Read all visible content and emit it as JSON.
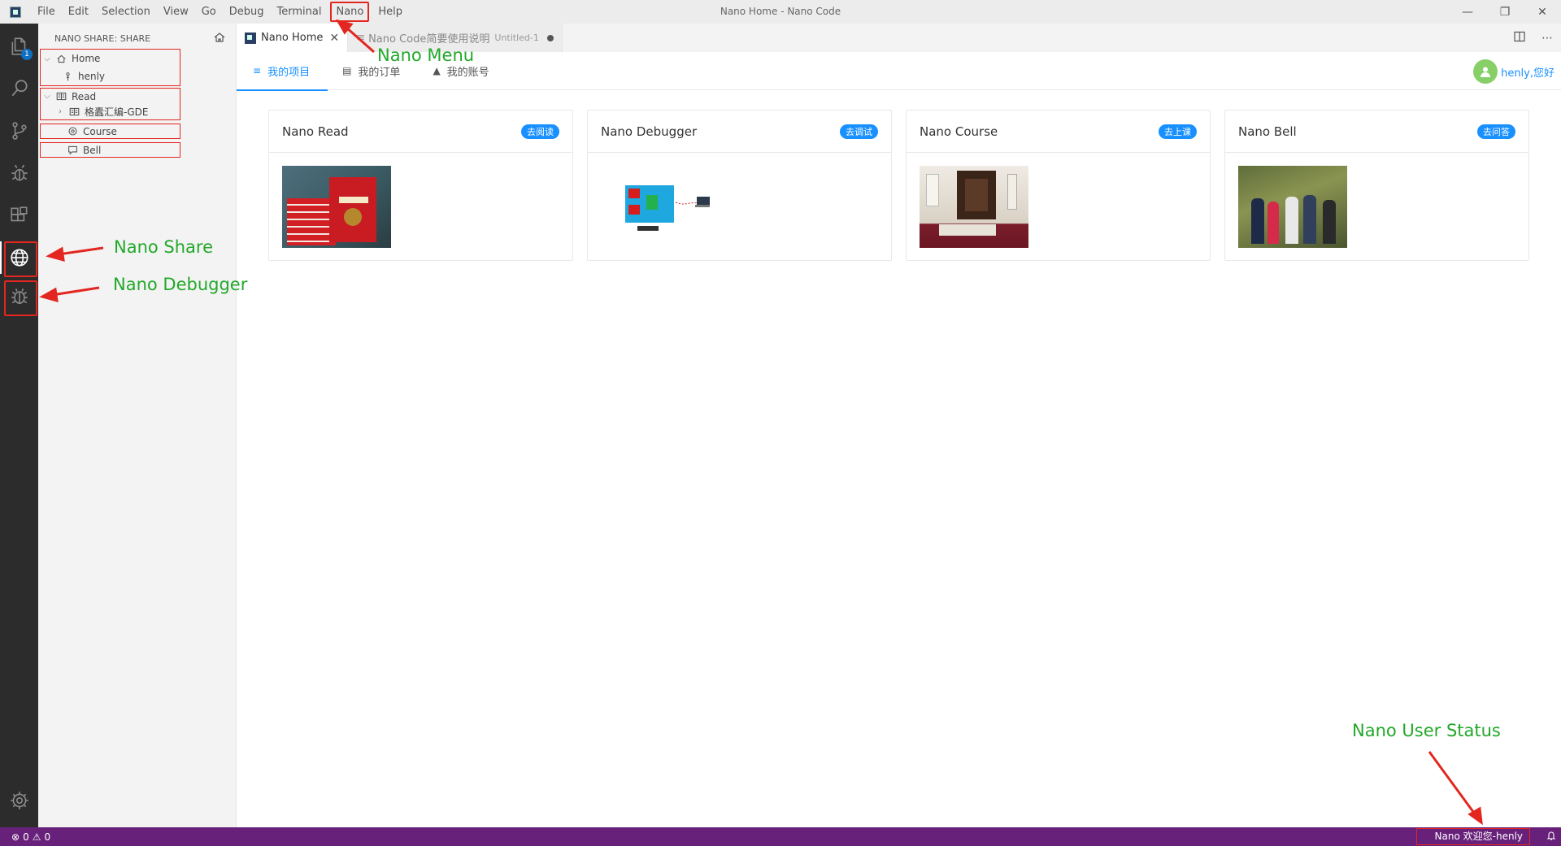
{
  "window": {
    "title": "Nano Home - Nano Code",
    "minimize": "—",
    "restore": "❐",
    "close": "✕"
  },
  "menu": [
    "File",
    "Edit",
    "Selection",
    "View",
    "Go",
    "Debug",
    "Terminal",
    "Nano",
    "Help"
  ],
  "activity": {
    "explorer_badge": "1"
  },
  "sidebar": {
    "title": "NANO SHARE: SHARE",
    "home": {
      "label": "Home",
      "child": "henly"
    },
    "read": {
      "label": "Read",
      "child": "格蠹汇编-GDE"
    },
    "course": {
      "label": "Course"
    },
    "bell": {
      "label": "Bell"
    }
  },
  "tabs": [
    {
      "label": "Nano Home",
      "close": "✕"
    },
    {
      "label": "Nano Code简要使用说明",
      "description": "Untitled-1"
    }
  ],
  "subnav": [
    {
      "label": "我的项目",
      "icon": "≡"
    },
    {
      "label": "我的订单",
      "icon": "▤"
    },
    {
      "label": "我的账号",
      "icon": "▲"
    }
  ],
  "user": {
    "greeting": "henly,您好"
  },
  "cards": [
    {
      "title": "Nano Read",
      "tag": "去阅读"
    },
    {
      "title": "Nano Debugger",
      "tag": "去调试"
    },
    {
      "title": "Nano Course",
      "tag": "去上课"
    },
    {
      "title": "Nano Bell",
      "tag": "去问答"
    }
  ],
  "annotations": {
    "menu": "Nano Menu",
    "share": "Nano Share",
    "debugger": "Nano Debugger",
    "user_status": "Nano User Status"
  },
  "statusbar": {
    "errors": "0",
    "warnings": "0",
    "user": "Nano 欢迎您-henly"
  },
  "colors": {
    "accent": "#1890ff",
    "statusbar": "#68217a",
    "annotation": "#22a82a",
    "highlight_box": "#e3261f"
  }
}
